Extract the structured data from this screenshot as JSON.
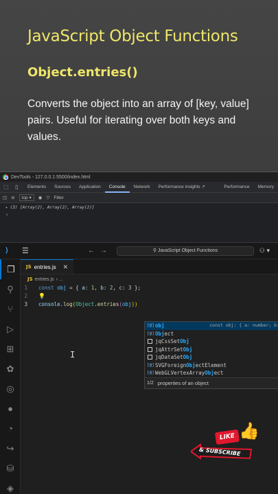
{
  "slide": {
    "title": "JavaScript Object Functions",
    "subtitle": "Object.entries()",
    "description": "Converts the object into an array of [key, value] pairs. Useful for iterating over both keys and values.",
    "accent_color": "#efe76a"
  },
  "devtools": {
    "window_title": "DevTools - 127.0.0.1:5500/index.html",
    "tabs": [
      "Elements",
      "Sources",
      "Application",
      "Console",
      "Network",
      "Performance insights ↗"
    ],
    "tabs_right": [
      "Performance",
      "Memory"
    ],
    "active_tab": "Console",
    "context_select": "top ▾",
    "filter_placeholder": "Filter",
    "output_line": "(3) [Array(2), Array(2), Array(2)]",
    "prompt": "›"
  },
  "vscode": {
    "search_text": "JavaScript Object Functions",
    "file_tab": "entries.js",
    "js_badge": "JS",
    "breadcrumb_file": "entries.js",
    "breadcrumb_rest": "› ...",
    "line_numbers": [
      "1",
      "2",
      "3"
    ],
    "code": {
      "l1_kw": "const",
      "l1_var": "obj",
      "l1_eq": " = { ",
      "l1_a": "a",
      "l1_c1": ": ",
      "l1_1": "1",
      "l1_s1": ", ",
      "l1_b": "b",
      "l1_c2": ": ",
      "l1_2": "2",
      "l1_s2": ", ",
      "l1_cc": "c",
      "l1_c3": ": ",
      "l1_3": "3",
      "l1_end": " };",
      "l3_console": "console",
      "l3_dot1": ".",
      "l3_log": "log",
      "l3_p1": "(",
      "l3_Object": "Object",
      "l3_dot2": ".",
      "l3_entries": "entries",
      "l3_p2": "(",
      "l3_obj": "obj",
      "l3_p3": "))"
    },
    "suggestions": [
      {
        "icon": "[@]",
        "pre": "",
        "match": "obj",
        "post": "",
        "detail": "const obj: { a: number; b:",
        "selected": true
      },
      {
        "icon": "[@]",
        "pre": "",
        "match": "Obj",
        "post": "ect",
        "detail": "",
        "selected": false
      },
      {
        "icon": "box",
        "pre": "jqCssSet",
        "match": "Obj",
        "post": "",
        "detail": "",
        "selected": false
      },
      {
        "icon": "box",
        "pre": "jqAttrSet",
        "match": "Obj",
        "post": "",
        "detail": "",
        "selected": false
      },
      {
        "icon": "box",
        "pre": "jqDataSet",
        "match": "Obj",
        "post": "",
        "detail": "",
        "selected": false
      },
      {
        "icon": "[@]",
        "pre": "SVGForeign",
        "match": "Obj",
        "post": "ectElement",
        "detail": "",
        "selected": false
      },
      {
        "icon": "[@]",
        "pre": "WebGLVertexArray",
        "match": "Obj",
        "post": "ect",
        "detail": "",
        "selected": false
      }
    ],
    "suggest_count": "1/2",
    "suggest_hint": "properties of an object"
  },
  "cta": {
    "like": "LIKE",
    "subscribe": "& SUBSCRIBE",
    "color": "#e0182d"
  }
}
